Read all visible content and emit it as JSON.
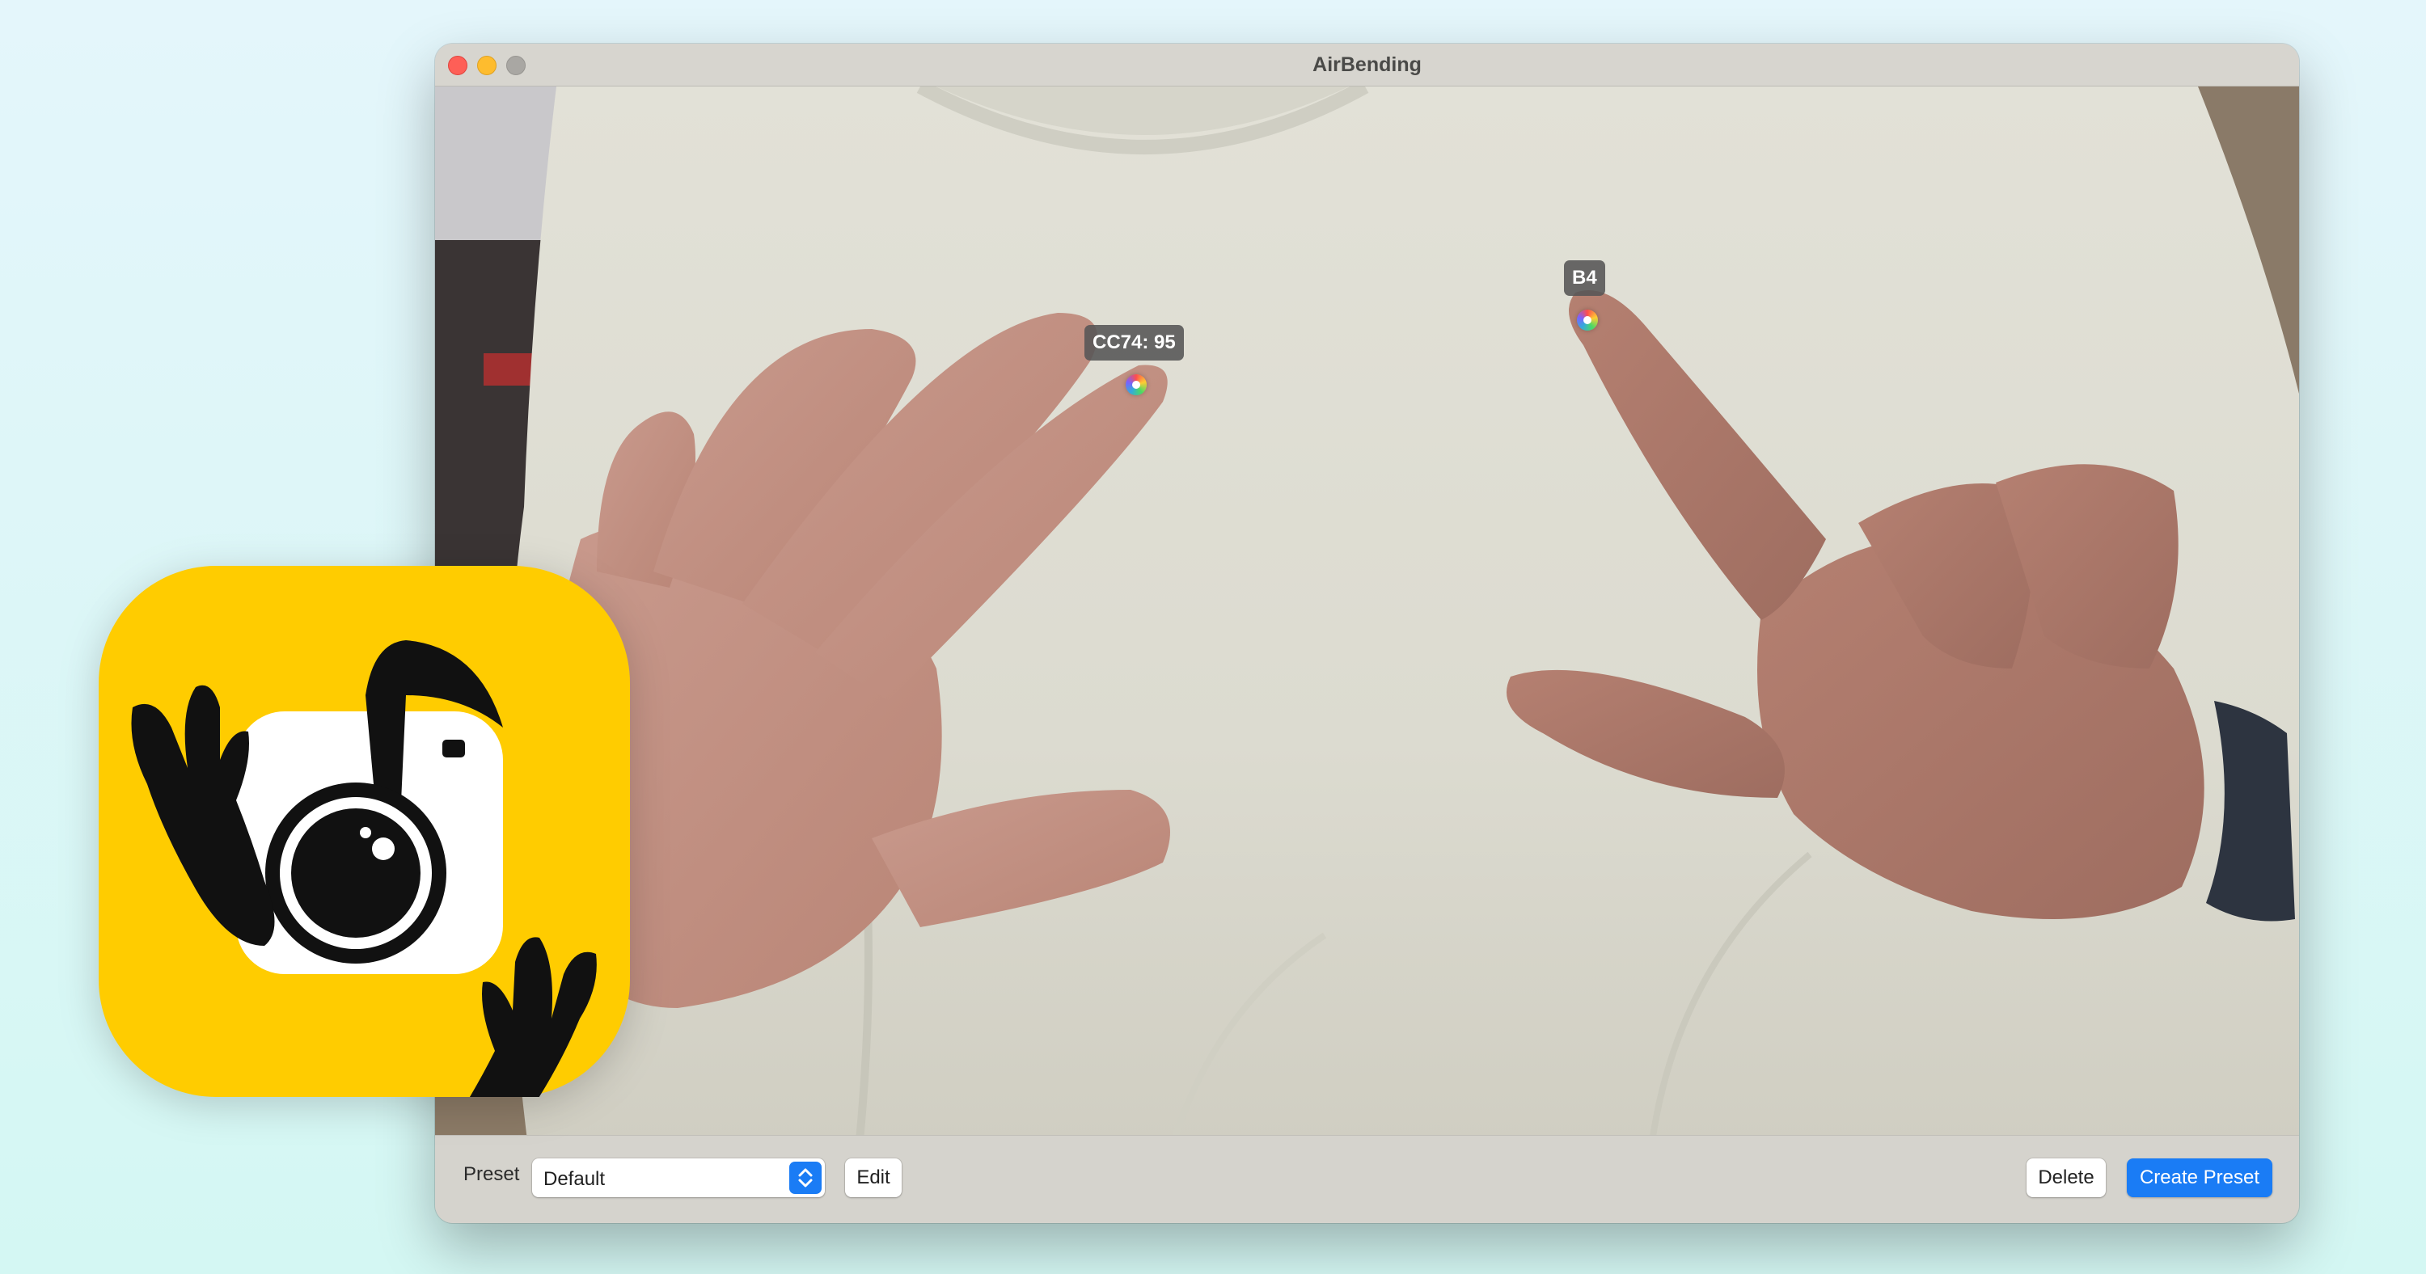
{
  "window": {
    "title": "AirBending"
  },
  "camera": {
    "markers": [
      {
        "label": "CC74: 95",
        "icon": "finger-tracking-dot"
      },
      {
        "label": "B4",
        "icon": "finger-tracking-dot"
      }
    ]
  },
  "toolbar": {
    "preset_label": "Preset",
    "preset_value": "Default",
    "edit_label": "Edit",
    "delete_label": "Delete",
    "create_label": "Create Preset"
  },
  "app_icon": {
    "icon": "camera-music-hands-icon",
    "background_color": "#ffcc00"
  },
  "colors": {
    "accent": "#1a7cf5",
    "close": "#fe5f57",
    "minimize": "#febc2e",
    "zoom_disabled": "#a9a7a3"
  }
}
